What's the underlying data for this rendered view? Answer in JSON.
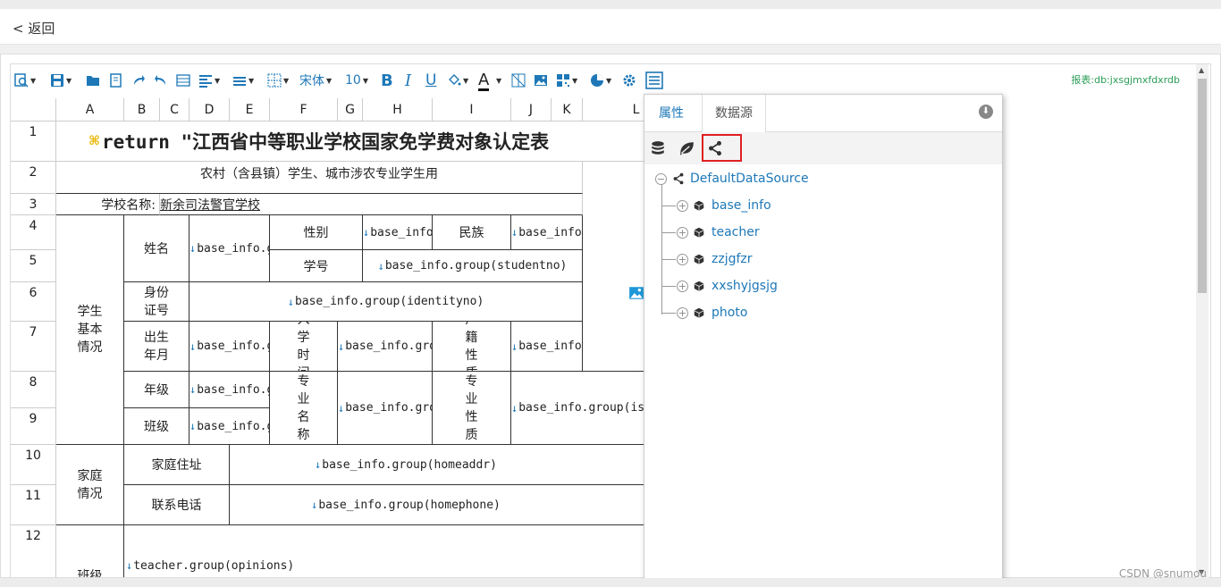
{
  "back": {
    "label": "< 返回"
  },
  "toolbar": {
    "font_name": "宋体",
    "font_size": "10",
    "bold": "B",
    "italic": "I",
    "underline": "U",
    "font_color": "A",
    "report_name": "报表:db:jxsgjmxfdxrdb"
  },
  "columns": [
    "A",
    "B",
    "C",
    "D",
    "E",
    "F",
    "G",
    "H",
    "I",
    "J",
    "K",
    "L"
  ],
  "rows": [
    "1",
    "2",
    "3",
    "4",
    "5",
    "6",
    "7",
    "8",
    "9",
    "10",
    "11",
    "12"
  ],
  "cells": {
    "title": "return \"江西省中等职业学校国家免学费对象认定表",
    "subtitle": "农村（含县镇）学生、城市涉农专业学生用",
    "school_label": "学校名称:",
    "school_value": "新余司法警官学校",
    "student_basic": "学生基本情况",
    "name_label": "姓名",
    "name_value": "base_info.gr",
    "gender_label": "性别",
    "gender_value": "base_info.",
    "nation_label": "民族",
    "nation_value": "base_info.",
    "studentno_label": "学号",
    "studentno_value": "base_info.group(studentno)",
    "id_label": "身份证号",
    "id_value": "base_info.group(identityno)",
    "birth_label": "出生年月",
    "birth_value": "base_info.gr",
    "enroll_label": "入学时间",
    "enroll_value": "base_info.grou",
    "household_label": "户籍性质",
    "household_value": "base_info.",
    "grade_label": "年级",
    "grade_value": "base_info.gr",
    "major_label": "专业名称",
    "major_value": "base_info.grou",
    "major_type_label": "专业性质",
    "major_type_value": "base_info.group(is_a",
    "class_label": "班级",
    "class_value": "base_info.gr",
    "family": "家庭情况",
    "home_addr_label": "家庭住址",
    "home_addr_value": "base_info.group(homeaddr)",
    "phone_label": "联系电话",
    "phone_value": "base_info.group(homephone)",
    "class_opinion_label": "班级",
    "opinion_value": "teacher.group(opinions)"
  },
  "panel": {
    "tab_properties": "属性",
    "tab_datasource": "数据源",
    "root": "DefaultDataSource",
    "datasets": [
      "base_info",
      "teacher",
      "zzjgfzr",
      "xxshyjgsjg",
      "photo"
    ]
  },
  "watermark": "CSDN @snumou",
  "colors": {
    "accent": "#1e78b8",
    "report_label": "#2a9d57",
    "highlight": "#e02020"
  }
}
